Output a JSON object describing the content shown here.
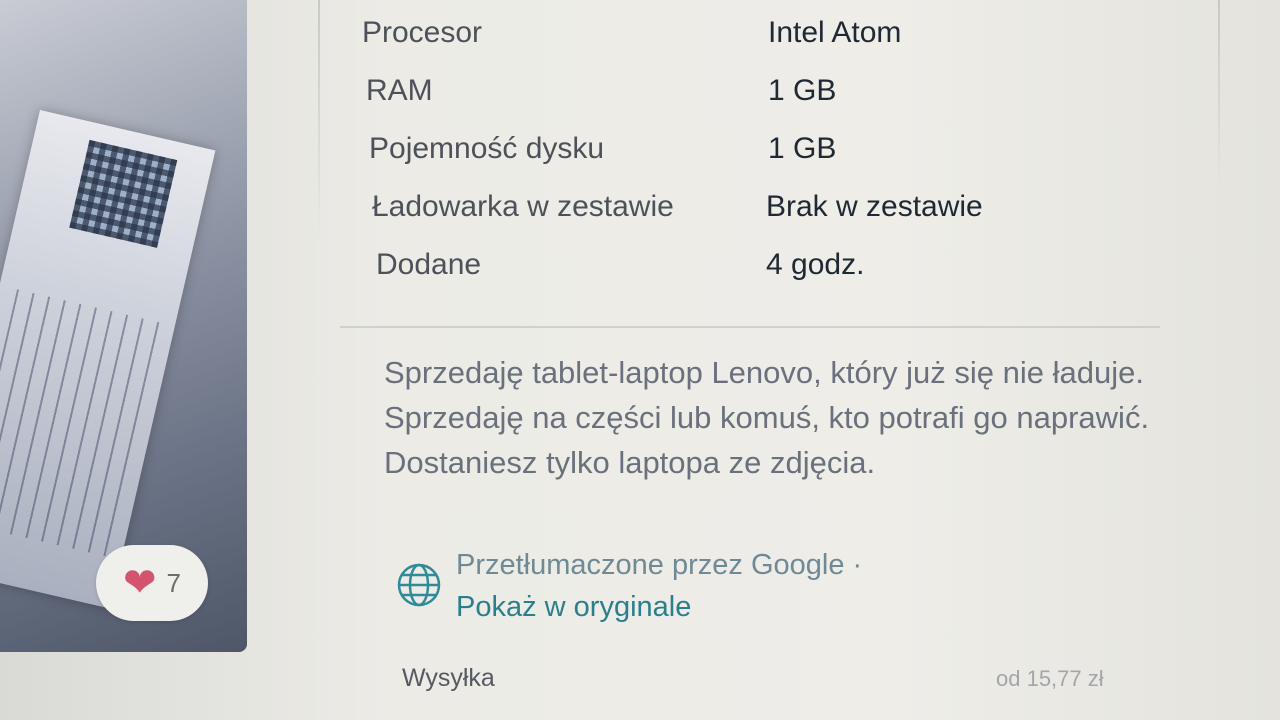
{
  "gallery": {
    "like_icon": "heart-icon",
    "like_count": "7"
  },
  "specs": [
    {
      "label": "Procesor",
      "value": "Intel Atom"
    },
    {
      "label": "RAM",
      "value": "1 GB"
    },
    {
      "label": "Pojemność dysku",
      "value": "1 GB"
    },
    {
      "label": "Ładowarka w zestawie",
      "value": "Brak w zestawie"
    },
    {
      "label": "Dodane",
      "value": "4 godz."
    }
  ],
  "description": "Sprzedaję tablet-laptop Lenovo, który już się nie ładuje. Sprzedaję na części lub komuś, kto potrafi go naprawić. Dostaniesz tylko laptopa ze zdjęcia.",
  "translation": {
    "icon": "globe-icon",
    "translated_by": "Przetłumaczone przez Google ·",
    "show_original": "Pokaż w oryginale"
  },
  "shipping": {
    "label": "Wysyłka",
    "price": "od 15,77 zł"
  },
  "colors": {
    "heart": "#d4546f",
    "link": "#2b7f8c",
    "globe": "#2f8a99"
  }
}
